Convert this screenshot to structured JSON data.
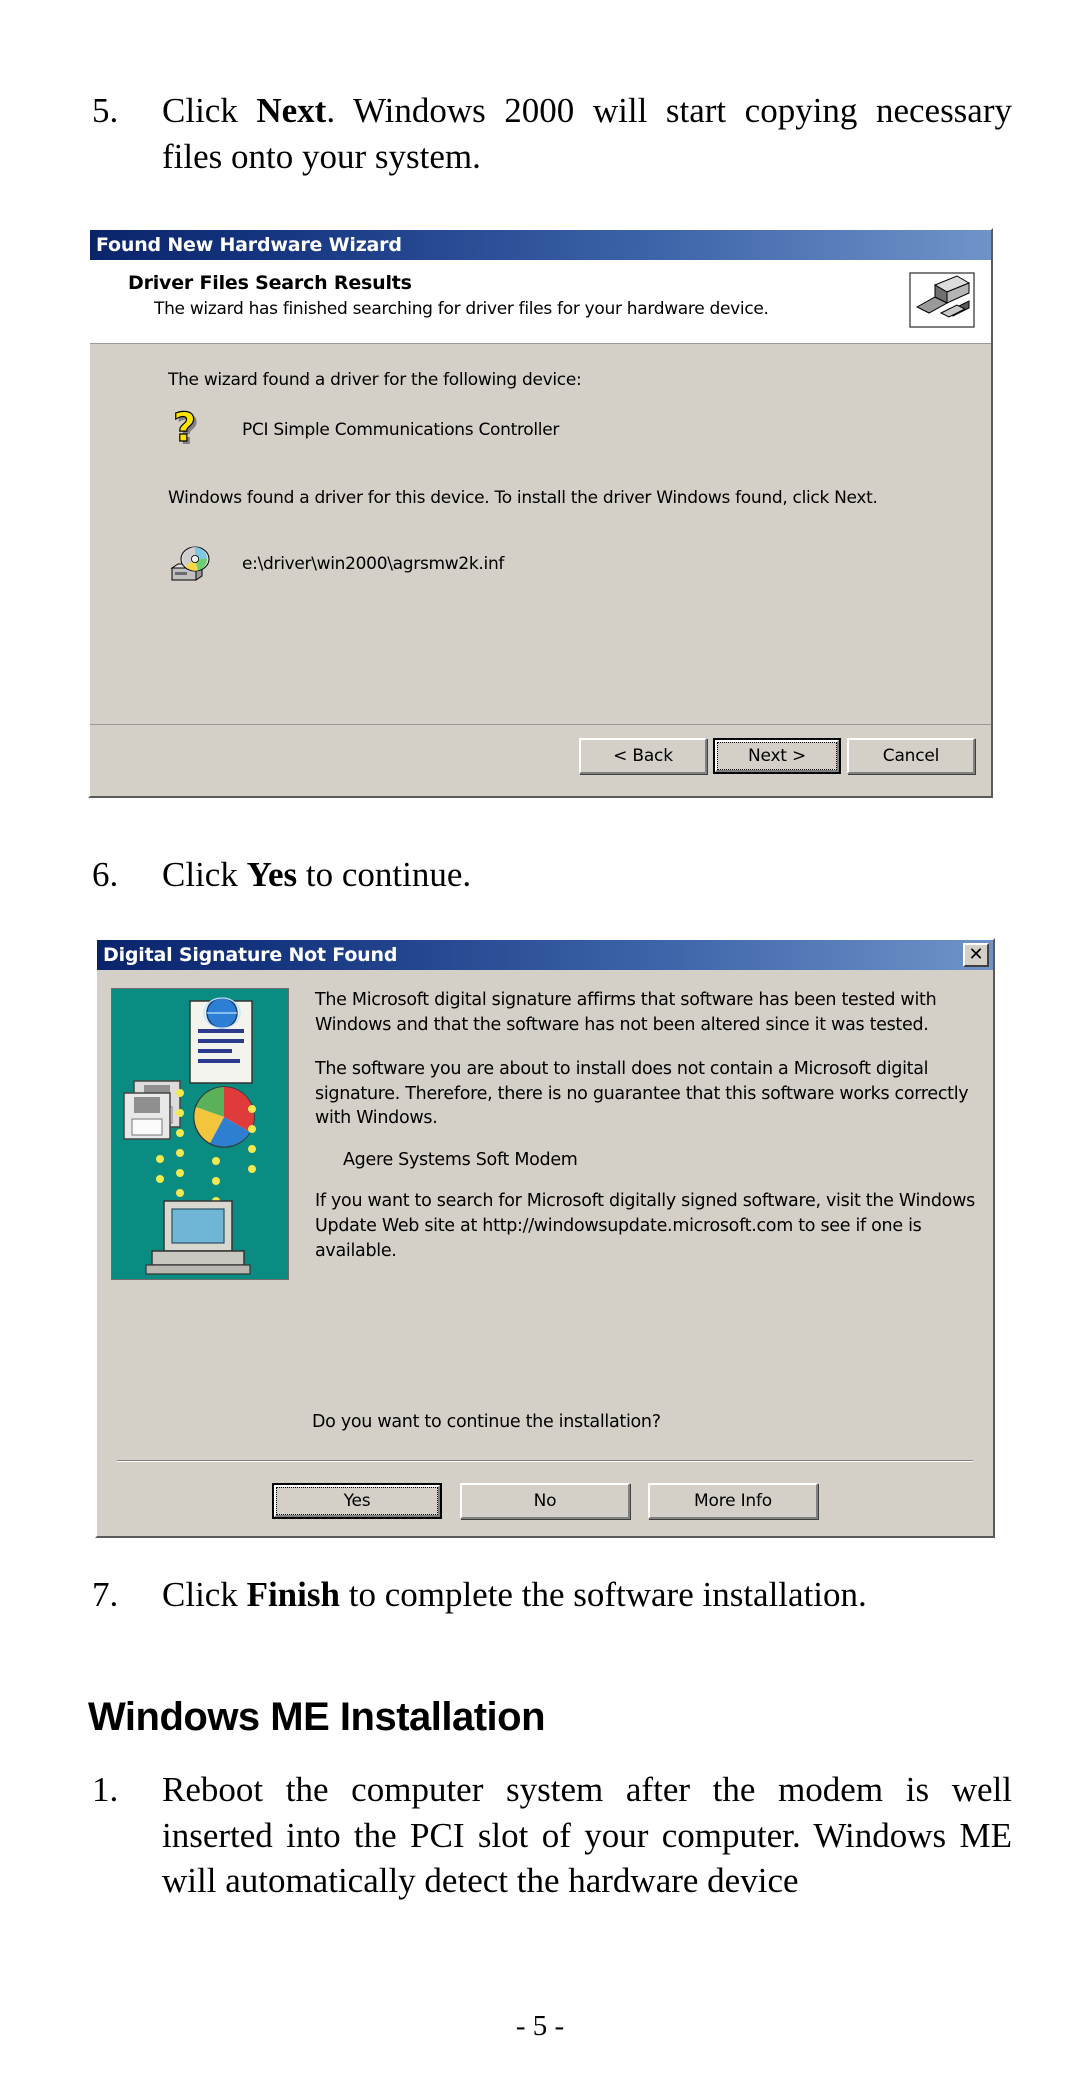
{
  "page": {
    "footer": "- 5 -"
  },
  "steps": {
    "step5": {
      "number": "5.",
      "text_pre": "Click ",
      "bold": "Next",
      "text_post": ".   Windows 2000 will start copying necessary files onto your system."
    },
    "step6": {
      "number": "6.",
      "text_pre": "Click ",
      "bold": "Yes",
      "text_post": " to continue."
    },
    "step7": {
      "number": "7.",
      "text_pre": "Click ",
      "bold": "Finish",
      "text_post": " to complete the software installation."
    }
  },
  "section": {
    "heading": "Windows ME Installation",
    "step1": {
      "number": "1.",
      "text": "Reboot the computer system after the modem is well inserted into the PCI slot of your computer. Windows ME will automatically detect the hardware device"
    }
  },
  "wizard_dialog": {
    "title": "Found New Hardware Wizard",
    "header_title": "Driver Files Search Results",
    "header_subtitle": "The wizard has finished searching for driver files for your hardware device.",
    "banner_icon": "hardware-wizard-icon",
    "found_line": "The wizard found a driver for the following device:",
    "device_icon": "question-mark-device-icon",
    "device_name": "PCI Simple Communications Controller",
    "install_line": "Windows found a driver for this device. To install the driver Windows found, click Next.",
    "driver_icon": "cdrom-drive-icon",
    "driver_path": "e:\\driver\\win2000\\agrsmw2k.inf",
    "buttons": {
      "back": "< Back",
      "back_accel": "B",
      "next": "Next >",
      "next_accel": "N",
      "cancel": "Cancel"
    }
  },
  "signature_dialog": {
    "title": "Digital Signature Not Found",
    "close_label": "✕",
    "close_icon": "close-icon",
    "illustration_icon": "digital-signature-illustration",
    "paragraph1": "The Microsoft digital signature affirms that software has been tested with Windows and that the software has not been altered since it was tested.",
    "paragraph2": "The software you are about to install does not contain a Microsoft digital signature. Therefore, there is no guarantee that this software works correctly with Windows.",
    "device_name": "Agere Systems Soft Modem",
    "paragraph3": "If you want to search for Microsoft digitally signed software, visit the Windows Update Web site at http://windowsupdate.microsoft.com to see if one is available.",
    "question": "Do you want to continue the installation?",
    "buttons": {
      "yes": "Yes",
      "yes_accel": "Y",
      "no": "No",
      "no_accel": "N",
      "more_info": "More Info",
      "more_info_accel": "M"
    }
  },
  "colors": {
    "titlebar_start": "#0a246a",
    "titlebar_end": "#6f93c9",
    "dialog_face": "#d4d0c8",
    "illustration_bg": "#0b8c82",
    "question_icon": "#ffe400"
  }
}
